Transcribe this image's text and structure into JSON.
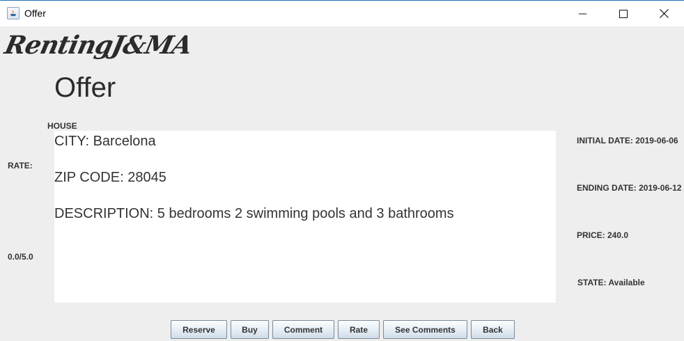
{
  "window": {
    "title": "Offer",
    "controls": {
      "minimize": "minimize-icon",
      "maximize": "maximize-icon",
      "close": "close-icon"
    }
  },
  "brand": "RentingJ&MA",
  "heading": "Offer",
  "offer": {
    "type": "HOUSE",
    "city": "CITY: Barcelona",
    "zip": "ZIP CODE: 28045",
    "description": "DESCRIPTION: 5 bedrooms 2 swimming pools and 3 bathrooms"
  },
  "rating": {
    "label": "RATE:",
    "value": "0.0/5.0"
  },
  "info": {
    "initial_date": "INITIAL DATE: 2019-06-06",
    "ending_date": "ENDING DATE: 2019-06-12",
    "price": "PRICE: 240.0",
    "state": "STATE: Available"
  },
  "buttons": {
    "reserve": "Reserve",
    "buy": "Buy",
    "comment": "Comment",
    "rate": "Rate",
    "see_comments": "See Comments",
    "back": "Back"
  }
}
